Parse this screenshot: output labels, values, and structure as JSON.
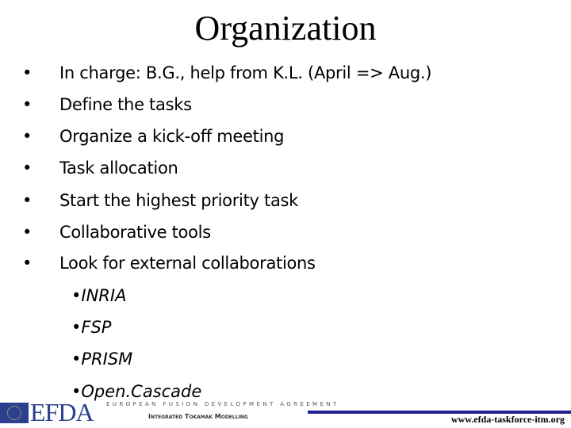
{
  "title": "Organization",
  "bullets": [
    "In charge: B.G., help from K.L. (April => Aug.)",
    "Define the tasks",
    "Organize a kick-off meeting",
    "Task allocation",
    "Start the highest priority task",
    "Collaborative tools",
    "Look for external collaborations"
  ],
  "sub_bullets": [
    "•INRIA",
    "•FSP",
    "•PRISM",
    "•Open.Cascade"
  ],
  "footer": {
    "logo": "EFDA",
    "org": "European Fusion Development Agreement",
    "project": "Integrated Tokamak Modelling",
    "url": "www.efda-taskforce-itm.org"
  }
}
